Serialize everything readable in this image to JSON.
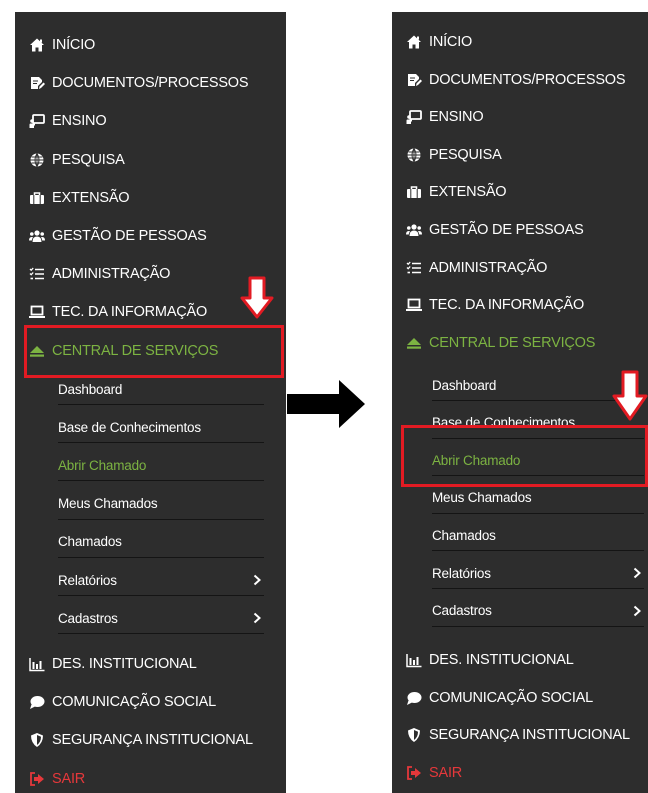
{
  "menu": {
    "items": [
      {
        "key": "inicio",
        "label": "INÍCIO",
        "icon": "home-icon"
      },
      {
        "key": "documentos",
        "label": "DOCUMENTOS/PROCESSOS",
        "icon": "document-edit-icon"
      },
      {
        "key": "ensino",
        "label": "ENSINO",
        "icon": "chalkboard-icon"
      },
      {
        "key": "pesquisa",
        "label": "PESQUISA",
        "icon": "globe-icon"
      },
      {
        "key": "extensao",
        "label": "EXTENSÃO",
        "icon": "briefcase-icon"
      },
      {
        "key": "gestao",
        "label": "GESTÃO DE PESSOAS",
        "icon": "users-icon"
      },
      {
        "key": "administracao",
        "label": "ADMINISTRAÇÃO",
        "icon": "list-icon"
      },
      {
        "key": "tec",
        "label": "TEC. DA INFORMAÇÃO",
        "icon": "laptop-icon"
      },
      {
        "key": "central",
        "label": "CENTRAL DE SERVIÇOS",
        "icon": "eject-icon",
        "active": true
      }
    ],
    "submenu": [
      {
        "key": "dashboard",
        "label": "Dashboard"
      },
      {
        "key": "base",
        "label": "Base de Conhecimentos"
      },
      {
        "key": "abrir",
        "label": "Abrir Chamado",
        "active": true
      },
      {
        "key": "meus",
        "label": "Meus Chamados"
      },
      {
        "key": "chamados",
        "label": "Chamados"
      },
      {
        "key": "relatorios",
        "label": "Relatórios",
        "has_children": true
      },
      {
        "key": "cadastros",
        "label": "Cadastros",
        "has_children": true
      }
    ],
    "bottom_items": [
      {
        "key": "des",
        "label": "DES. INSTITUCIONAL",
        "icon": "bar-chart-icon"
      },
      {
        "key": "comunicacao",
        "label": "COMUNICAÇÃO SOCIAL",
        "icon": "chat-bubble-icon"
      },
      {
        "key": "seguranca",
        "label": "SEGURANÇA INSTITUCIONAL",
        "icon": "shield-icon"
      },
      {
        "key": "sair",
        "label": "SAIR",
        "icon": "sign-out-icon",
        "danger": true
      }
    ]
  },
  "colors": {
    "panel_bg": "#2d2d2d",
    "text": "#ffffff",
    "active": "#7cb342",
    "danger": "#e5383b",
    "annotation": "#e21b23",
    "arrow": "#000000"
  }
}
